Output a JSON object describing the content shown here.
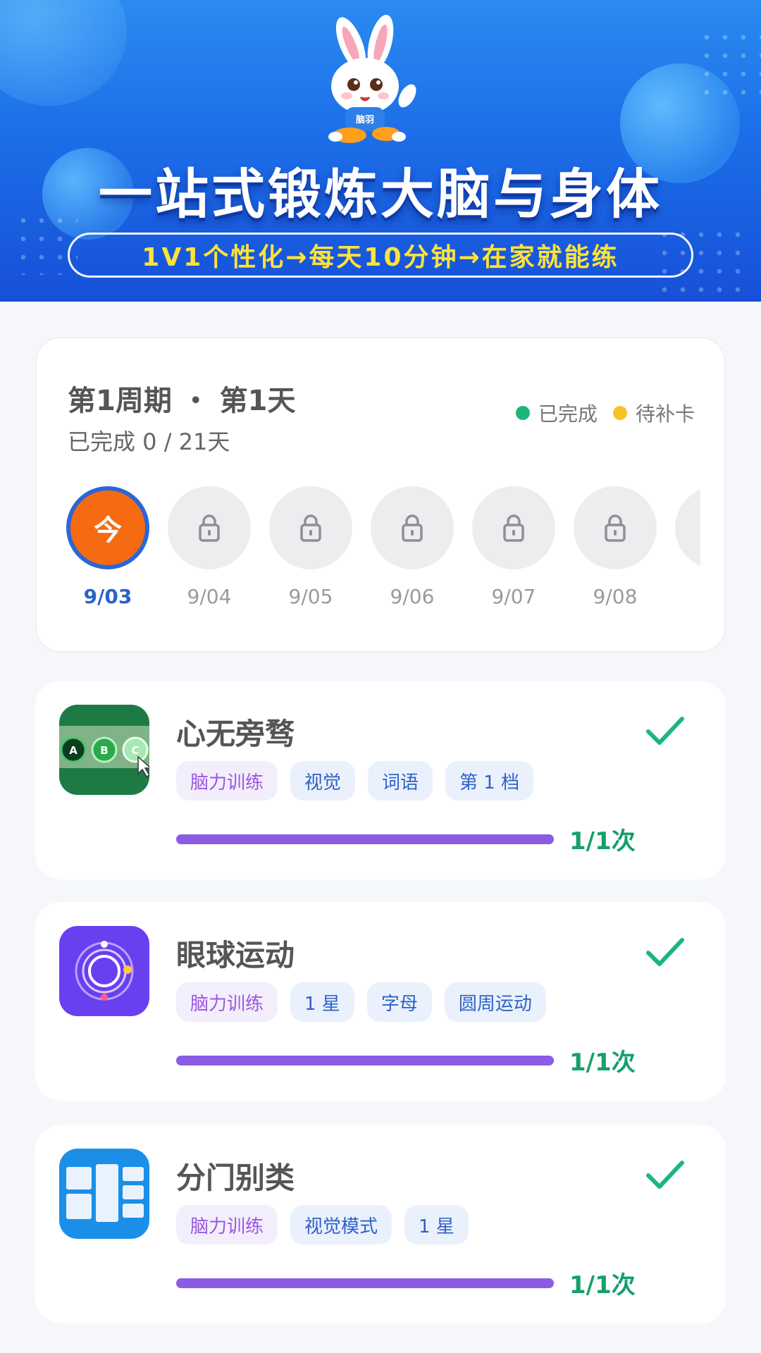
{
  "banner": {
    "mascot_badge": "脑羽",
    "title": "一站式锻炼大脑与身体",
    "subtitle": "1V1个性化→每天10分钟→在家就能练"
  },
  "week": {
    "title": "第1周期 ・ 第1天",
    "progress_text": "已完成 0 / 21天",
    "legend": [
      {
        "label": "已完成",
        "color": "#1cb67a"
      },
      {
        "label": "待补卡",
        "color": "#f7c22a"
      }
    ],
    "days": [
      {
        "label": "今",
        "date": "9/03",
        "state": "today"
      },
      {
        "label": "",
        "date": "9/04",
        "state": "locked"
      },
      {
        "label": "",
        "date": "9/05",
        "state": "locked"
      },
      {
        "label": "",
        "date": "9/06",
        "state": "locked"
      },
      {
        "label": "",
        "date": "9/07",
        "state": "locked"
      },
      {
        "label": "",
        "date": "9/08",
        "state": "locked"
      }
    ]
  },
  "tasks": [
    {
      "name": "心无旁骛",
      "icon": "abc-circles-icon",
      "tile_letters": [
        "A",
        "B",
        "C"
      ],
      "tags": [
        {
          "label": "脑力训练",
          "style": "purple"
        },
        {
          "label": "视觉",
          "style": "blue"
        },
        {
          "label": "词语",
          "style": "blue"
        },
        {
          "label": "第 1 档",
          "style": "blue"
        }
      ],
      "progress": 1.0,
      "count": "1/1次",
      "done": true
    },
    {
      "name": "眼球运动",
      "icon": "orbit-icon",
      "tags": [
        {
          "label": "脑力训练",
          "style": "purple"
        },
        {
          "label": "1 星",
          "style": "blue"
        },
        {
          "label": "字母",
          "style": "blue"
        },
        {
          "label": "圆周运动",
          "style": "blue"
        }
      ],
      "progress": 1.0,
      "count": "1/1次",
      "done": true
    },
    {
      "name": "分门别类",
      "icon": "grid-blocks-icon",
      "tags": [
        {
          "label": "脑力训练",
          "style": "purple"
        },
        {
          "label": "视觉模式",
          "style": "blue"
        },
        {
          "label": "1 星",
          "style": "blue"
        }
      ],
      "progress": 1.0,
      "count": "1/1次",
      "done": true
    }
  ],
  "colors": {
    "accent_purple": "#8b5be6",
    "success_green": "#16a06b",
    "today_orange": "#f66a12",
    "today_ring_blue": "#2b66d8"
  }
}
